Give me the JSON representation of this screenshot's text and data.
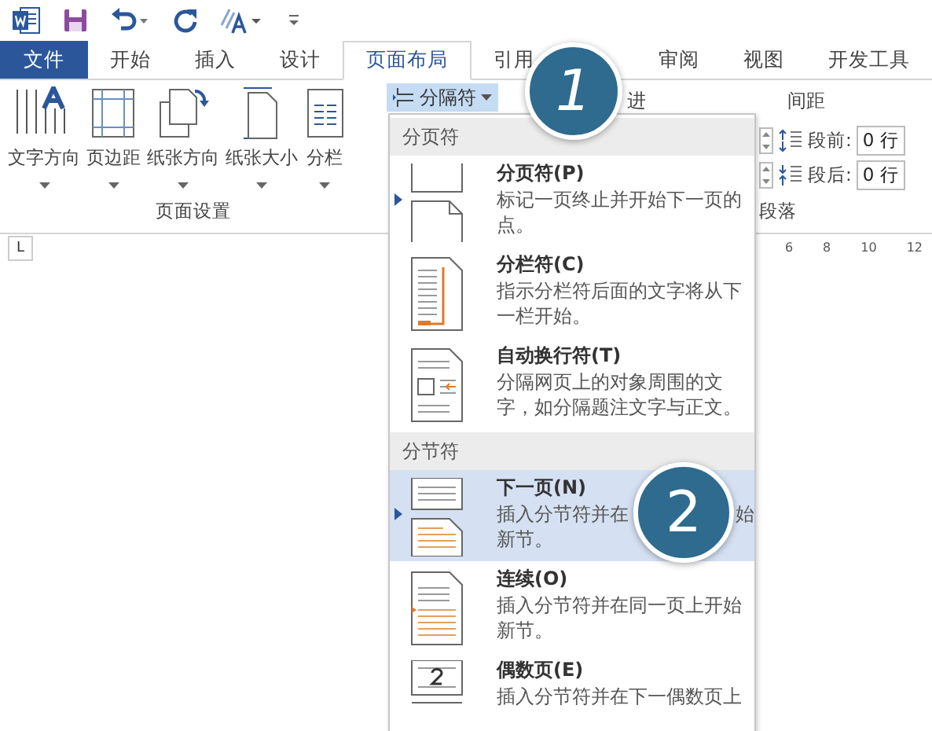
{
  "tabs": [
    {
      "label": "文件",
      "kind": "file",
      "selected": false
    },
    {
      "label": "开始",
      "kind": "tab",
      "selected": false
    },
    {
      "label": "插入",
      "kind": "tab",
      "selected": false
    },
    {
      "label": "设计",
      "kind": "tab",
      "selected": false
    },
    {
      "label": "页面布局",
      "kind": "tab",
      "selected": true
    },
    {
      "label": "引用",
      "kind": "tab",
      "selected": false
    },
    {
      "label": "审阅",
      "kind": "tab",
      "selected": false
    },
    {
      "label": "视图",
      "kind": "tab",
      "selected": false
    },
    {
      "label": "开发工具",
      "kind": "tab",
      "selected": false
    }
  ],
  "page_setup": {
    "buttons": [
      {
        "label": "文字方向",
        "kind": "text-direction"
      },
      {
        "label": "页边距",
        "kind": "margins"
      },
      {
        "label": "纸张方向",
        "kind": "orientation"
      },
      {
        "label": "纸张大小",
        "kind": "size"
      },
      {
        "label": "分栏",
        "kind": "columns"
      }
    ],
    "group_label": "页面设置"
  },
  "breaks_button": {
    "label": "分隔符",
    "selected": true
  },
  "indent_label": "进",
  "spacing": {
    "label": "间距",
    "rows": [
      {
        "label": "段前:",
        "value": "0 行",
        "kind": "before"
      },
      {
        "label": "段后:",
        "value": "0 行",
        "kind": "after"
      }
    ]
  },
  "paragraph_group_label": "段落",
  "ruler": {
    "tab_marker": "L",
    "numbers": [
      "6",
      "8",
      "10",
      "12"
    ]
  },
  "breaks_menu": {
    "sections": [
      {
        "heading": "分页符",
        "items": [
          {
            "title": "分页符(P)",
            "description": "标记一页终止并开始下一页的点。",
            "kind": "page",
            "selected": false
          },
          {
            "title": "分栏符(C)",
            "description": "指示分栏符后面的文字将从下一栏开始。",
            "kind": "column",
            "selected": false
          },
          {
            "title": "自动换行符(T)",
            "description": "分隔网页上的对象周围的文字，如分隔题注文字与正文。",
            "kind": "wrap",
            "selected": false
          }
        ]
      },
      {
        "heading": "分节符",
        "items": [
          {
            "title": "下一页(N)",
            "description_parts": [
              "插入分节符并在",
              "始",
              "新节。"
            ],
            "kind": "next",
            "selected": true
          },
          {
            "title": "连续(O)",
            "description": "插入分节符并在同一页上开始新节。",
            "kind": "continuous",
            "selected": false
          },
          {
            "title": "偶数页(E)",
            "description": "插入分节符并在下一偶数页上",
            "kind": "even",
            "selected": false
          }
        ]
      }
    ]
  },
  "callouts": [
    {
      "label": "1",
      "kind": "tab-area"
    },
    {
      "label": "2",
      "kind": "menu-item"
    }
  ]
}
